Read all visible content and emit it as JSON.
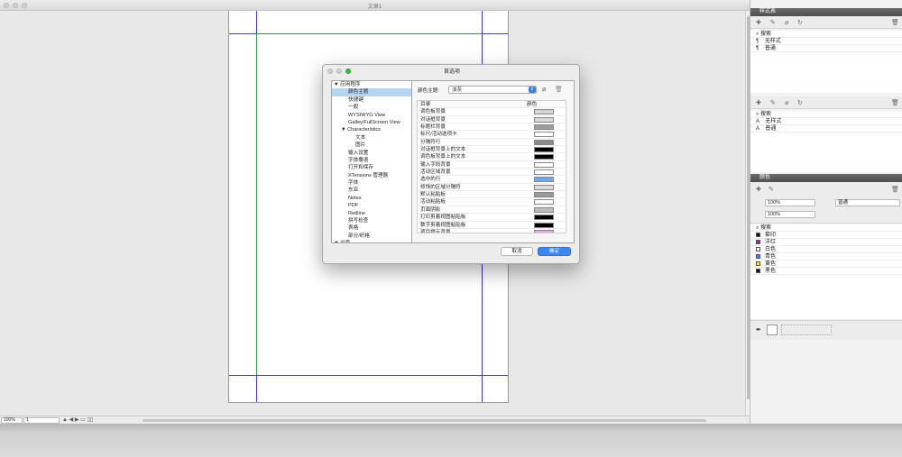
{
  "window": {
    "title": "文章1"
  },
  "dialog": {
    "title": "首选项",
    "tree": [
      {
        "label": "▼ 应用程序",
        "level": 0,
        "selected": false
      },
      {
        "label": "颜色主题",
        "level": 2,
        "selected": true
      },
      {
        "label": "快捷键",
        "level": 2,
        "selected": false
      },
      {
        "label": "一般",
        "level": 2,
        "selected": false
      },
      {
        "label": "WYSIWYG View",
        "level": 2,
        "selected": false
      },
      {
        "label": "Galley/FullScreen View",
        "level": 2,
        "selected": false
      },
      {
        "label": "▼ Characteristics",
        "level": 1,
        "selected": false
      },
      {
        "label": "文本",
        "level": 3,
        "selected": false
      },
      {
        "label": "图片",
        "level": 3,
        "selected": false
      },
      {
        "label": "输入设置",
        "level": 2,
        "selected": false
      },
      {
        "label": "字体撒退",
        "level": 2,
        "selected": false
      },
      {
        "label": "打开和保存",
        "level": 2,
        "selected": false
      },
      {
        "label": "XTensions 管理器",
        "level": 2,
        "selected": false
      },
      {
        "label": "字体",
        "level": 2,
        "selected": false
      },
      {
        "label": "东亚",
        "level": 2,
        "selected": false
      },
      {
        "label": "Notes",
        "level": 2,
        "selected": false
      },
      {
        "label": "PDF",
        "level": 2,
        "selected": false
      },
      {
        "label": "Redline",
        "level": 2,
        "selected": false
      },
      {
        "label": "拼写检查",
        "level": 2,
        "selected": false
      },
      {
        "label": "表格",
        "level": 2,
        "selected": false
      },
      {
        "label": "部分/织格",
        "level": 2,
        "selected": false
      },
      {
        "label": "▼ 文章",
        "level": 0,
        "selected": false
      }
    ],
    "theme_label": "颜色主题:",
    "theme_value": "淡灰",
    "table_header": {
      "item": "目录",
      "color": "颜色"
    },
    "color_rows": [
      {
        "label": "调色板背景",
        "color": "#d3d3d3"
      },
      {
        "label": "对话框背景",
        "color": "#d8d8d8"
      },
      {
        "label": "标题栏背景",
        "color": "#9c9c9c"
      },
      {
        "label": "标尺/活动选项卡",
        "color": "#ffffff"
      },
      {
        "label": "分隔符行",
        "color": "#8c8c8c"
      },
      {
        "label": "对话框背景上的文本",
        "color": "#000000"
      },
      {
        "label": "调色板背景上的文本",
        "color": "#000000"
      },
      {
        "label": "输入字段背景",
        "color": "#ffffff"
      },
      {
        "label": "活动区域背景",
        "color": "#ffffff"
      },
      {
        "label": "选中的行",
        "color": "#6fa8ec"
      },
      {
        "label": "修饰的区域分隔符",
        "color": "#dcdcdc"
      },
      {
        "label": "默认粘贴板",
        "color": "#9a9a9a"
      },
      {
        "label": "活动粘贴板",
        "color": "#ffffff"
      },
      {
        "label": "页面阴影",
        "color": "#bdbdbd"
      },
      {
        "label": "打印剪着视图粘贴板",
        "color": "#000000"
      },
      {
        "label": "数字剪着视图粘贴板",
        "color": "#000000"
      },
      {
        "label": "项目提示背景",
        "color": "#f0a0e8"
      }
    ],
    "cancel": "取消",
    "ok": "确定"
  },
  "styles_panel": {
    "title": "样式表",
    "search": "搜索",
    "para_items": [
      "无样式",
      "普通"
    ],
    "char_items": [
      "无样式",
      "普通"
    ]
  },
  "colors_panel": {
    "title": "颜色",
    "opacity_1": "100%",
    "opacity_2": "100%",
    "blend": "普通",
    "search": "搜索",
    "items": [
      {
        "name": "套印",
        "swatch": "#111111"
      },
      {
        "name": "洋红",
        "swatch": "#e0008a"
      },
      {
        "name": "白色",
        "swatch": "#ffffff"
      },
      {
        "name": "青色",
        "swatch": "#00a0e4"
      },
      {
        "name": "黄色",
        "swatch": "#f4e400"
      },
      {
        "name": "黑色",
        "swatch": "#111111"
      }
    ]
  },
  "statusbar": {
    "zoom": "100%",
    "page": "1"
  }
}
